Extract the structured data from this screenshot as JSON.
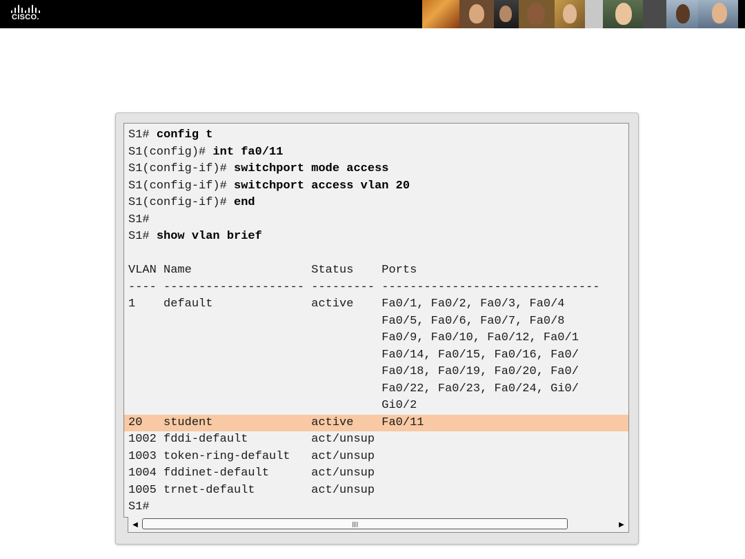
{
  "banner": {
    "logo_text": "CISCO.",
    "colors": {
      "background": "#000000",
      "logo": "#ffffff"
    }
  },
  "terminal": {
    "lines": [
      {
        "prompt": "S1# ",
        "cmd": "config t"
      },
      {
        "prompt": "S1(config)# ",
        "cmd": "int fa0/11"
      },
      {
        "prompt": "S1(config-if)# ",
        "cmd": "switchport mode access"
      },
      {
        "prompt": "S1(config-if)# ",
        "cmd": "switchport access vlan 20"
      },
      {
        "prompt": "S1(config-if)# ",
        "cmd": "end"
      },
      {
        "prompt": "S1#",
        "cmd": ""
      },
      {
        "prompt": "S1# ",
        "cmd": "show vlan brief"
      },
      {
        "prompt": "",
        "cmd": ""
      },
      {
        "prompt": "VLAN Name                 Status    Ports",
        "cmd": ""
      },
      {
        "prompt": "---- -------------------- --------- -------------------------------",
        "cmd": ""
      },
      {
        "prompt": "1    default              active    Fa0/1, Fa0/2, Fa0/3, Fa0/4",
        "cmd": ""
      },
      {
        "prompt": "                                    Fa0/5, Fa0/6, Fa0/7, Fa0/8",
        "cmd": ""
      },
      {
        "prompt": "                                    Fa0/9, Fa0/10, Fa0/12, Fa0/1",
        "cmd": ""
      },
      {
        "prompt": "                                    Fa0/14, Fa0/15, Fa0/16, Fa0/",
        "cmd": ""
      },
      {
        "prompt": "                                    Fa0/18, Fa0/19, Fa0/20, Fa0/",
        "cmd": ""
      },
      {
        "prompt": "                                    Fa0/22, Fa0/23, Fa0/24, Gi0/",
        "cmd": ""
      },
      {
        "prompt": "                                    Gi0/2",
        "cmd": ""
      },
      {
        "prompt": "20   student              active    Fa0/11",
        "cmd": "",
        "highlight": true
      },
      {
        "prompt": "1002 fddi-default         act/unsup",
        "cmd": ""
      },
      {
        "prompt": "1003 token-ring-default   act/unsup",
        "cmd": ""
      },
      {
        "prompt": "1004 fddinet-default      act/unsup",
        "cmd": ""
      },
      {
        "prompt": "1005 trnet-default        act/unsup",
        "cmd": ""
      },
      {
        "prompt": "S1#",
        "cmd": ""
      }
    ],
    "colors": {
      "background": "#f1f1f1",
      "text": "#1b1b1b",
      "highlight": "#f8c9a4"
    }
  },
  "scrollbar": {
    "left_icon": "arrow-left-icon",
    "right_icon": "arrow-right-icon",
    "grip_icon": "grip-icon"
  }
}
